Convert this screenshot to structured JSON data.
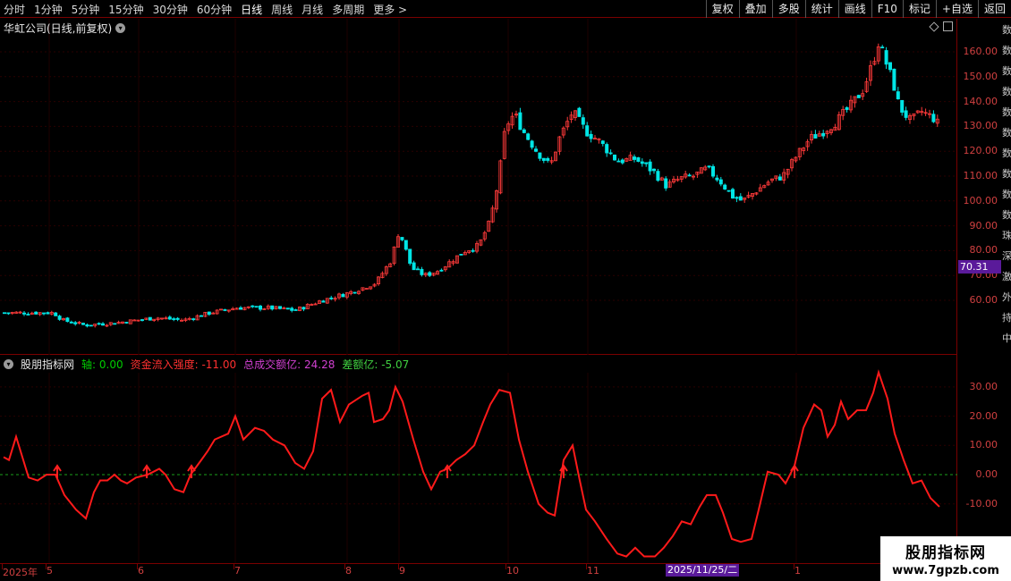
{
  "toolbar": {
    "periods": [
      "分时",
      "1分钟",
      "5分钟",
      "15分钟",
      "30分钟",
      "60分钟",
      "日线",
      "周线",
      "月线",
      "多周期",
      "更多 >"
    ],
    "active_period": "日线",
    "buttons": [
      "复权",
      "叠加",
      "多股",
      "统计",
      "画线",
      "F10",
      "标记",
      "+自选",
      "返回"
    ]
  },
  "main_chart": {
    "title": "华虹公司(日线,前复权)",
    "current_price_tag": "70.31",
    "y_labels": [
      "160.00",
      "150.00",
      "140.00",
      "130.00",
      "120.00",
      "110.00",
      "100.00",
      "90.00",
      "80.00",
      "70.00",
      "60.00"
    ],
    "colors": {
      "up": "#ff3a3a",
      "down": "#00e5e5",
      "axis": "#d04040",
      "grid": "#3a0000"
    }
  },
  "indicator": {
    "name": "股朋指标网",
    "axis_label": "轴: 0.00",
    "flow_label": "资金流入强度: -11.00",
    "total_label": "总成交额亿: 24.28",
    "diff_label": "差额亿: -5.07",
    "y_labels": [
      "30.00",
      "20.00",
      "10.00",
      "0.00",
      "-10.00"
    ],
    "colors": {
      "line": "#ff1a1a",
      "axis": "#00cc00",
      "total": "#d040d0",
      "diff": "#40d040"
    }
  },
  "time_axis": {
    "labels": [
      "2025年",
      "5",
      "6",
      "7",
      "8",
      "9",
      "10",
      "11",
      "1"
    ],
    "cursor_date": "2025/11/25/二"
  },
  "right_strip": [
    "数",
    "数",
    "数",
    "数",
    "数",
    "数",
    "数",
    "数",
    "数",
    "数",
    "珠",
    "深",
    "激",
    "外",
    "持",
    "中"
  ],
  "watermark": {
    "line1": "股朋指标网",
    "line2": "www.7gpzb.com"
  },
  "chart_data": {
    "type": "line",
    "title": "",
    "series": [
      {
        "name": "资金流入强度",
        "x_dates_approx": [
          "2025-04",
          "2025-05",
          "2025-06",
          "2025-07",
          "2025-08",
          "2025-09",
          "2025-10",
          "2025-11",
          "2025-12",
          "2026-01"
        ],
        "values": [
          8,
          -2,
          0,
          -5,
          0,
          0,
          18,
          18,
          12,
          8,
          5,
          25,
          18,
          25,
          29,
          18,
          0,
          -3,
          10,
          5,
          28,
          -8,
          10,
          -15,
          -25,
          -20,
          -10,
          -20,
          0,
          20,
          20,
          25,
          20,
          35,
          15,
          0,
          -5,
          -11
        ]
      }
    ],
    "ylim": [
      -28,
      38
    ]
  }
}
